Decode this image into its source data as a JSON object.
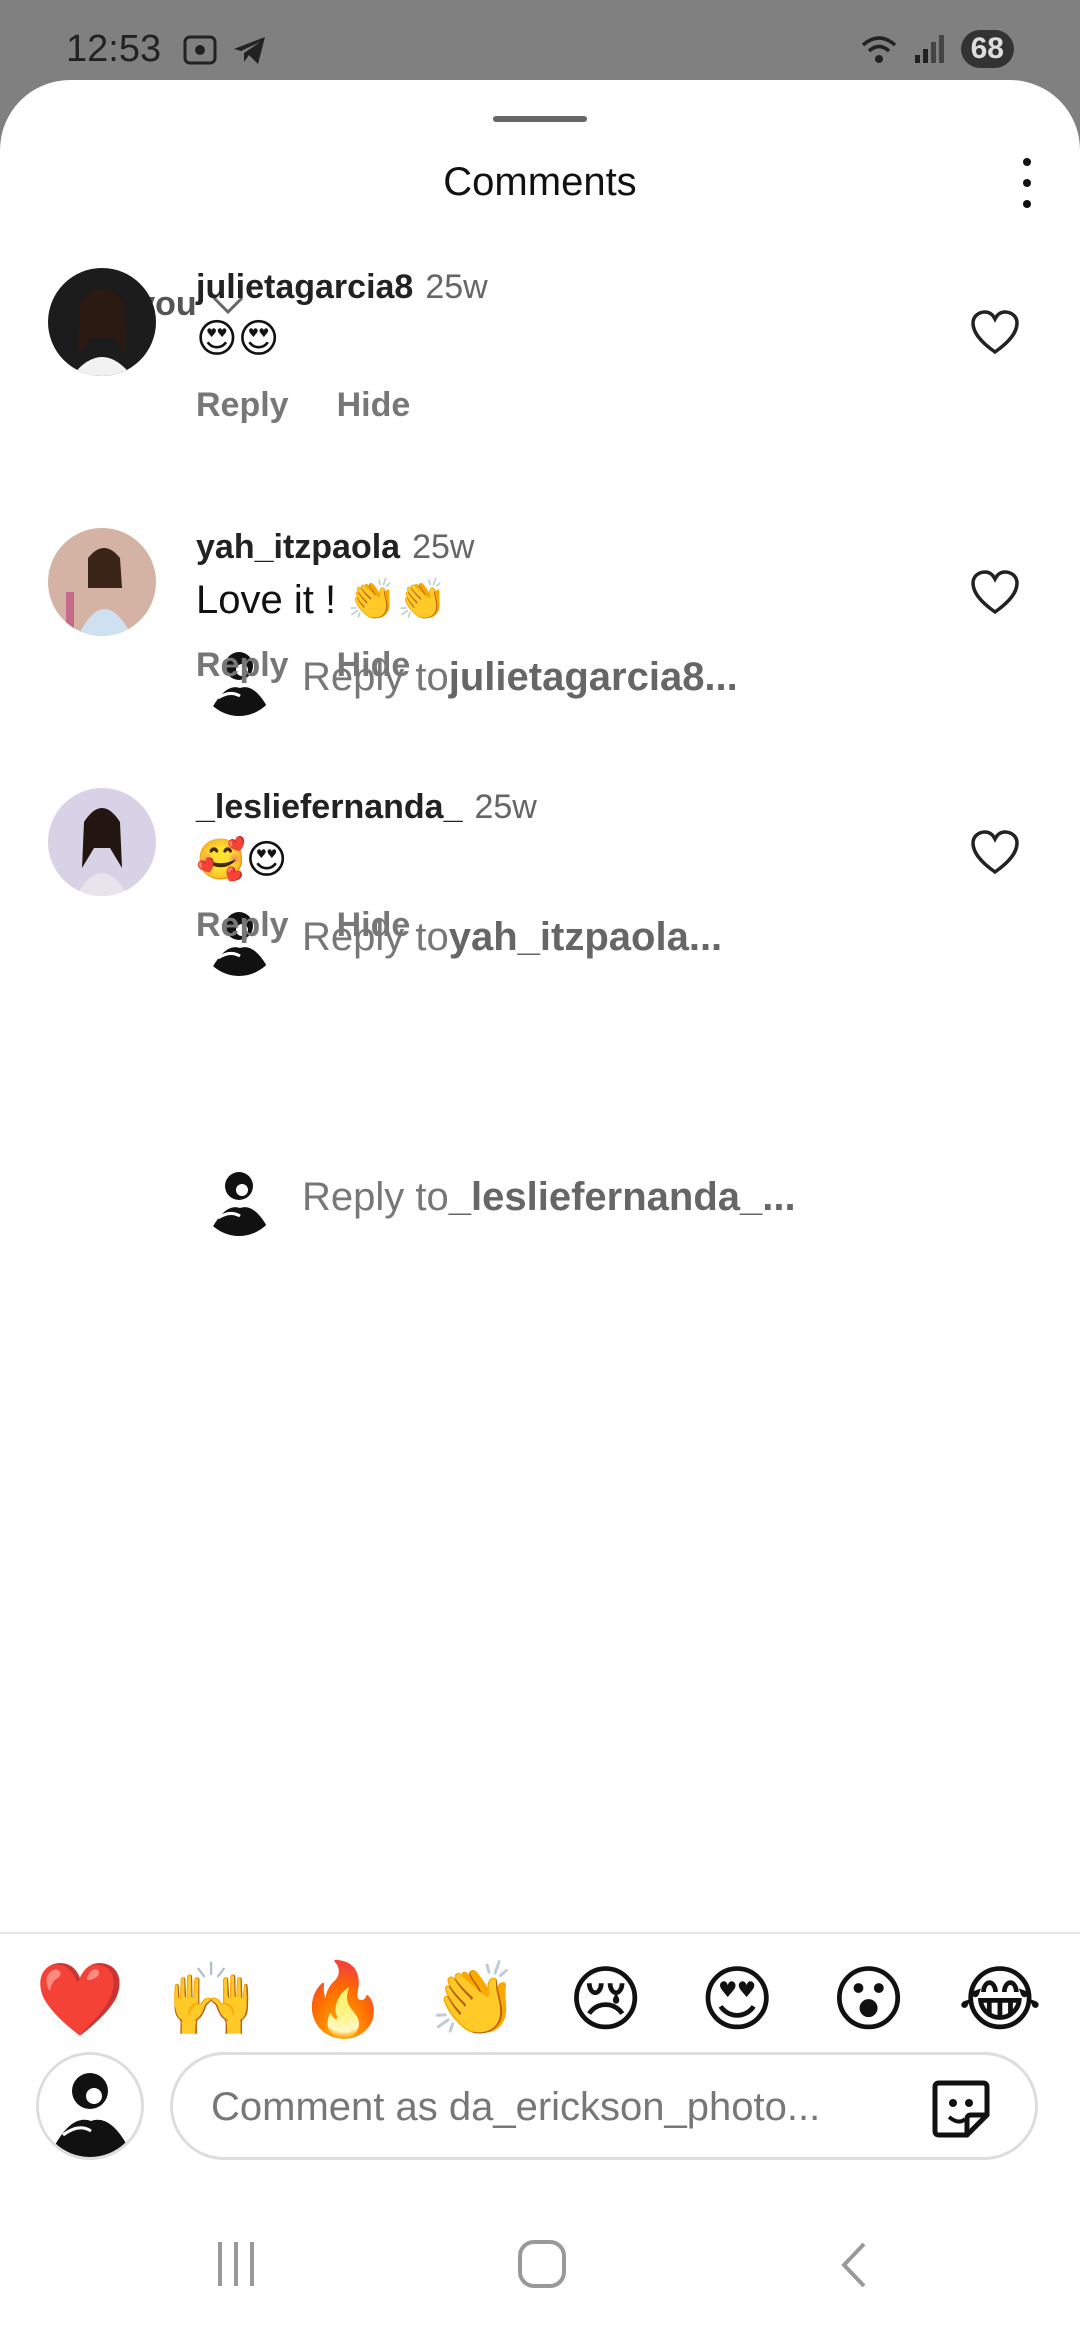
{
  "status_bar": {
    "time": "12:53",
    "battery": "68"
  },
  "header": {
    "title": "Comments"
  },
  "sort": {
    "label": "For you"
  },
  "comments": [
    {
      "username": "julietagarcia8",
      "time": "25w",
      "text": "😍😍",
      "reply_label": "Reply",
      "hide_label": "Hide",
      "reply_prefix": "Reply to ",
      "reply_user": "julietagarcia8..."
    },
    {
      "username": "yah_itzpaola",
      "time": "25w",
      "text": "Love it ! 👏👏",
      "reply_label": "Reply",
      "hide_label": "Hide",
      "reply_prefix": "Reply to ",
      "reply_user": "yah_itzpaola..."
    },
    {
      "username": "_lesliefernanda_",
      "time": "25w",
      "text": "🥰😍",
      "reply_label": "Reply",
      "hide_label": "Hide",
      "reply_prefix": "Reply to ",
      "reply_user": "_lesliefernanda_..."
    }
  ],
  "quick_emojis": [
    "❤️",
    "🙌",
    "🔥",
    "👏",
    "😢",
    "😍",
    "😮",
    "😂"
  ],
  "composer": {
    "placeholder": "Comment as da_erickson_photo..."
  },
  "colors": {
    "sheet": "#ffffff",
    "backdrop": "#808080",
    "heart": "#ff3040"
  }
}
